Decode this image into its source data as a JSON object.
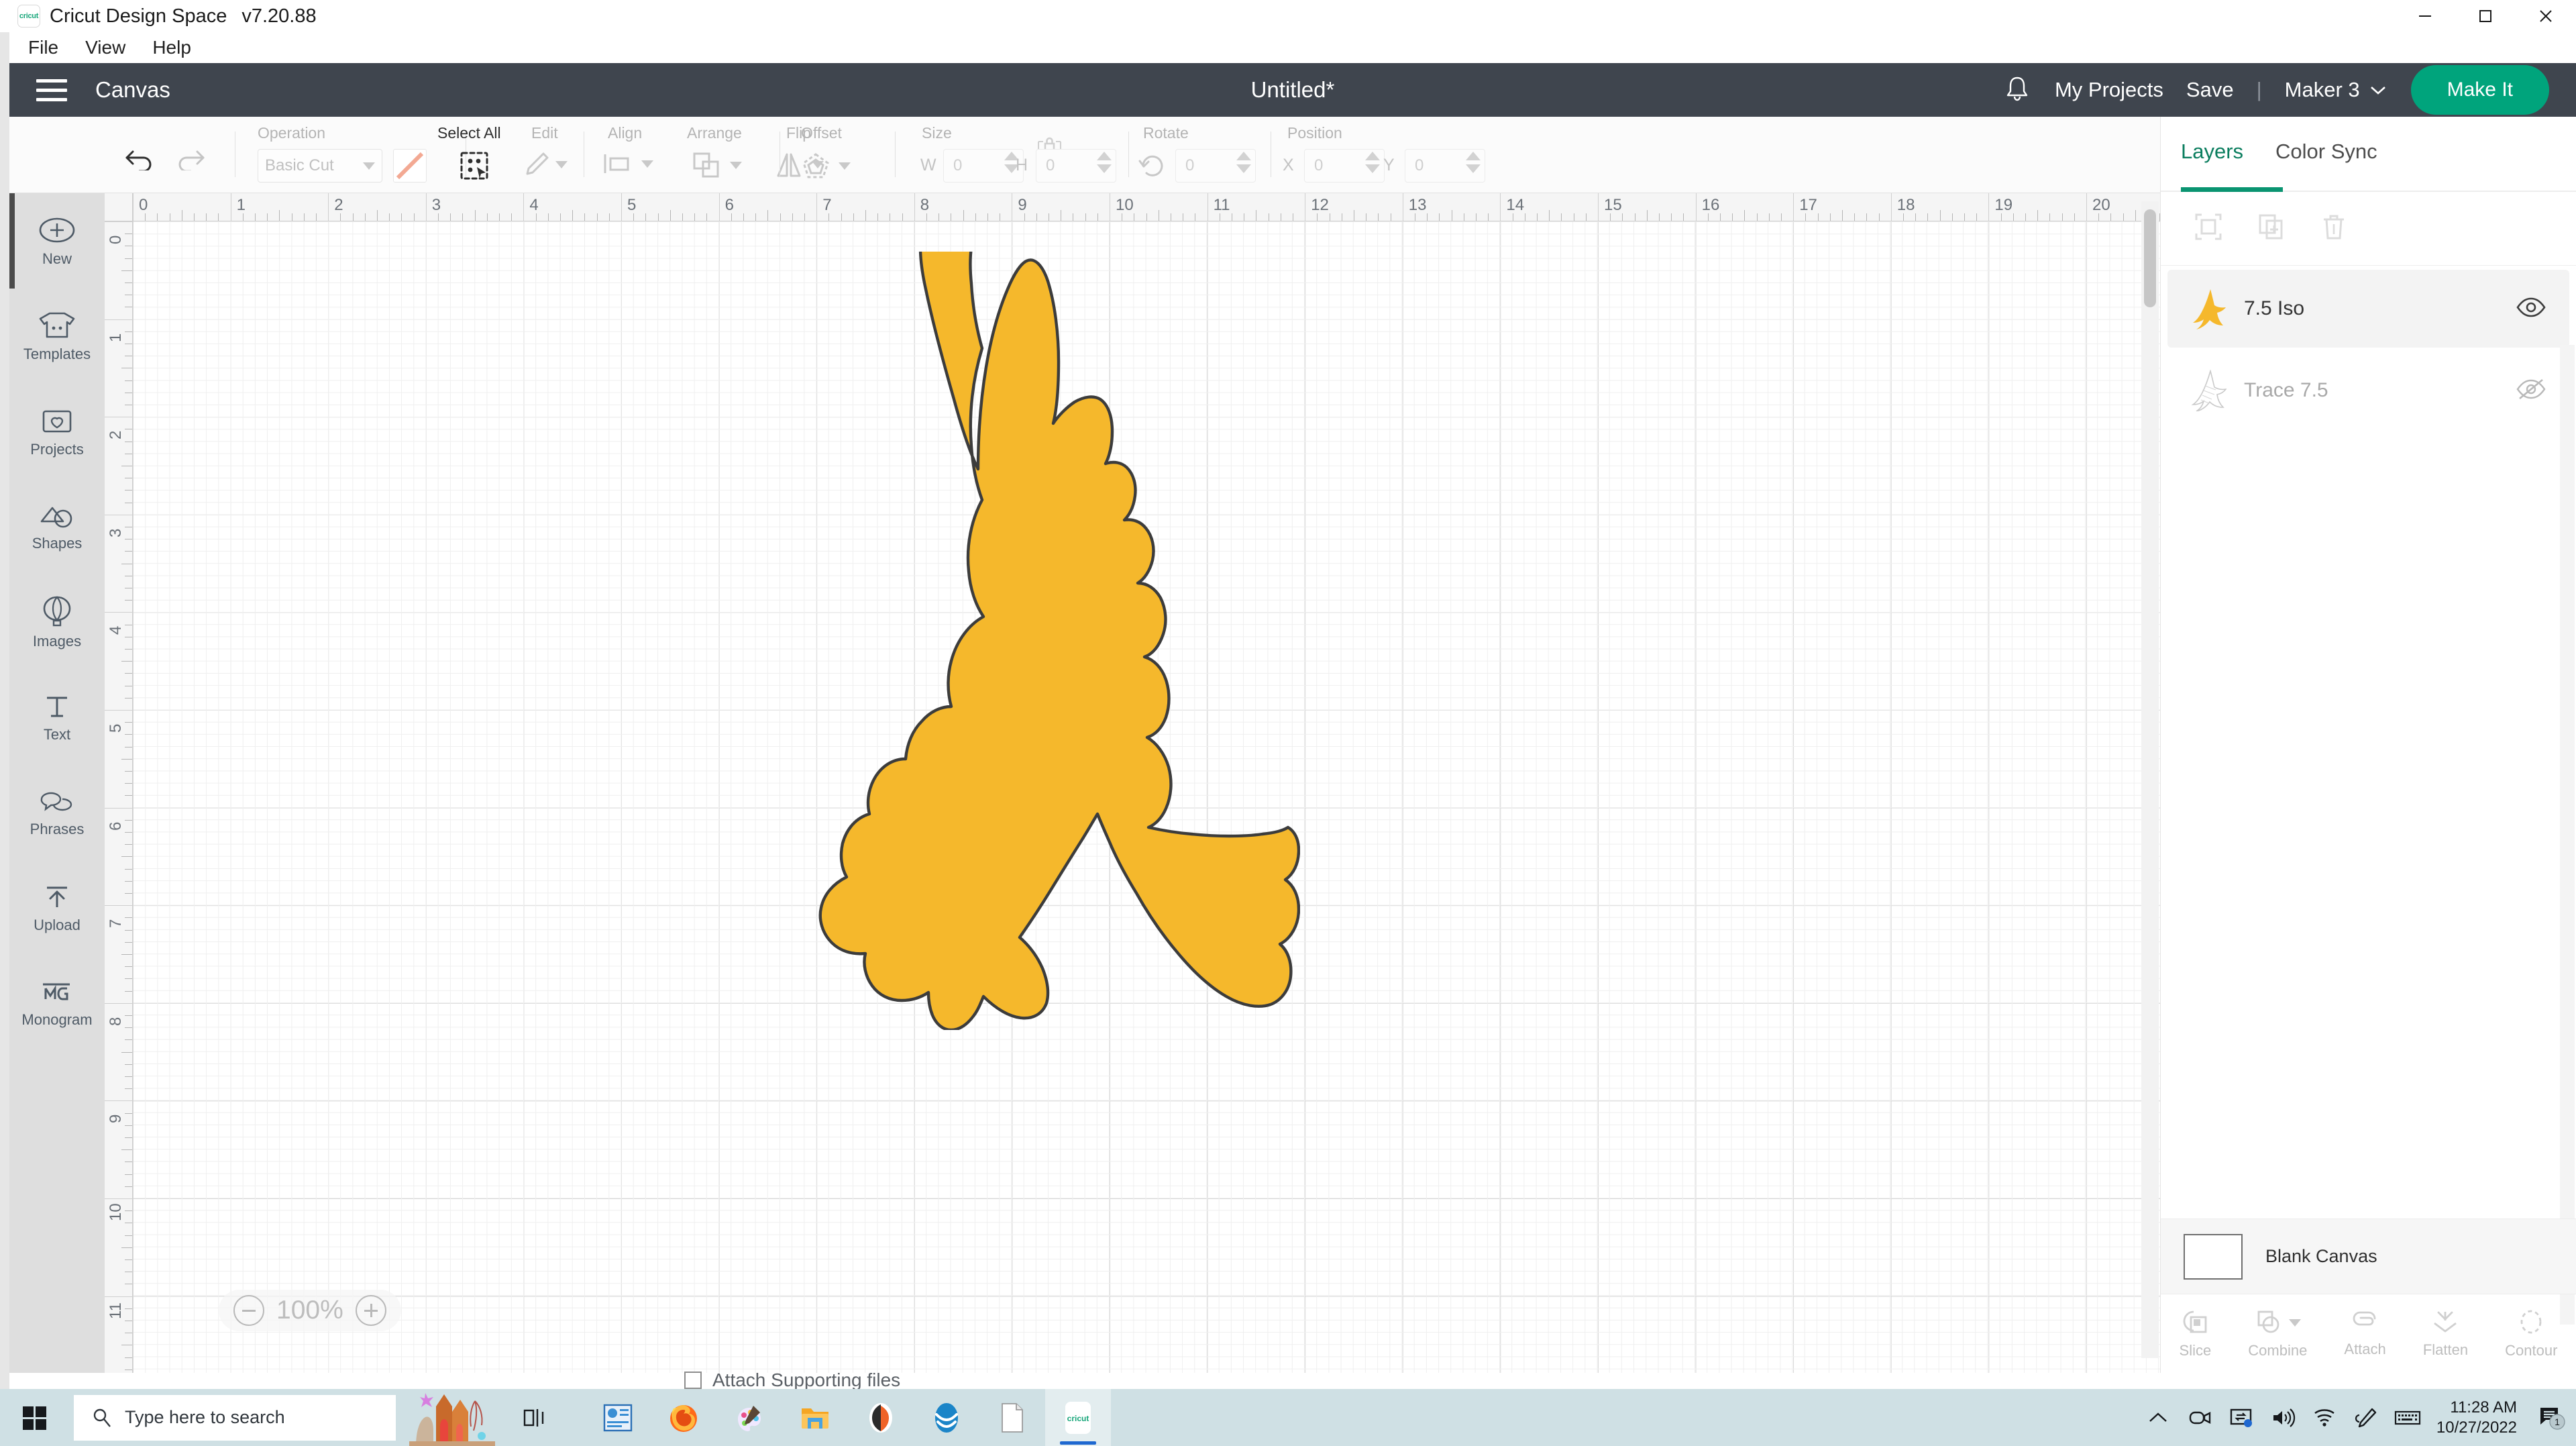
{
  "window": {
    "app_name": "Cricut Design Space",
    "version": "v7.20.88",
    "logo_text": "cricut",
    "menu": [
      "File",
      "View",
      "Help"
    ],
    "controls": {
      "minimize": "minimize-icon",
      "maximize": "maximize-icon",
      "close": "close-icon"
    }
  },
  "header": {
    "menu_icon": "hamburger-icon",
    "canvas_label": "Canvas",
    "project_title": "Untitled*",
    "bell_icon": "notification-bell-icon",
    "my_projects": "My Projects",
    "save": "Save",
    "divider": "|",
    "machine": "Maker 3",
    "machine_caret": "chevron-down-icon",
    "make_it": "Make It",
    "bg_color": "#3f454e",
    "accent_color": "#00a47c"
  },
  "toolbar": {
    "undo_icon": "undo-icon",
    "redo_icon": "redo-icon",
    "operation_label": "Operation",
    "operation_value": "Basic Cut",
    "color_swatch": "#f3a993",
    "select_all_label": "Select All",
    "edit_label": "Edit",
    "align_label": "Align",
    "arrange_label": "Arrange",
    "flip_label": "Flip",
    "offset_label": "Offset",
    "size_label": "Size",
    "size_w_label": "W",
    "size_w_value": "0",
    "size_h_label": "H",
    "size_h_value": "0",
    "lock_icon": "lock-icon",
    "rotate_label": "Rotate",
    "rotate_value": "0",
    "position_label": "Position",
    "position_x_label": "X",
    "position_x_value": "0",
    "position_y_label": "Y",
    "position_y_value": "0"
  },
  "sidebar": {
    "items": [
      {
        "label": "New",
        "icon": "plus-circle-icon"
      },
      {
        "label": "Templates",
        "icon": "tshirt-icon"
      },
      {
        "label": "Projects",
        "icon": "projects-card-icon"
      },
      {
        "label": "Shapes",
        "icon": "shapes-icon"
      },
      {
        "label": "Images",
        "icon": "hot-air-balloon-icon"
      },
      {
        "label": "Text",
        "icon": "text-t-icon"
      },
      {
        "label": "Phrases",
        "icon": "speech-bubbles-icon"
      },
      {
        "label": "Upload",
        "icon": "upload-arrow-icon"
      },
      {
        "label": "Monogram",
        "icon": "monogram-icon"
      }
    ]
  },
  "canvas": {
    "ruler_h_labels": [
      "0",
      "1",
      "2",
      "3",
      "4",
      "5",
      "6",
      "7",
      "8",
      "9",
      "10",
      "11",
      "12",
      "13",
      "14",
      "15",
      "16",
      "17",
      "18",
      "19",
      "20"
    ],
    "ruler_v_labels": [
      "0",
      "1",
      "2",
      "3",
      "4",
      "5",
      "6",
      "7",
      "8",
      "9",
      "10",
      "11"
    ],
    "zoom_level": "100%",
    "zoom_out_icon": "zoom-out-icon",
    "zoom_in_icon": "zoom-in-icon",
    "artwork_name": "flying-bird-silhouette",
    "artwork_fill": "#f5b82c",
    "artwork_stroke": "#3c3c3c"
  },
  "right_panel": {
    "tabs": [
      {
        "label": "Layers",
        "active": true
      },
      {
        "label": "Color Sync",
        "active": false
      }
    ],
    "layer_tools": [
      {
        "name": "duplicate-selection-icon"
      },
      {
        "name": "add-layer-icon"
      },
      {
        "name": "delete-layer-icon"
      }
    ],
    "layers": [
      {
        "name": "7.5 Iso",
        "thumb": "bird-filled-thumb",
        "visible": true,
        "visibility_icon": "eye-icon",
        "selected": true,
        "dim": false
      },
      {
        "name": "Trace 7.5",
        "thumb": "bird-outline-thumb",
        "visible": false,
        "visibility_icon": "eye-off-icon",
        "selected": false,
        "dim": true
      }
    ],
    "blank_canvas_label": "Blank Canvas",
    "operations": [
      {
        "label": "Slice",
        "icon": "slice-icon"
      },
      {
        "label": "Combine",
        "icon": "combine-icon"
      },
      {
        "label": "Attach",
        "icon": "attach-paperclip-icon"
      },
      {
        "label": "Flatten",
        "icon": "flatten-icon"
      },
      {
        "label": "Contour",
        "icon": "contour-icon"
      }
    ]
  },
  "background_window": {
    "text": "Attach Supporting files"
  },
  "taskbar": {
    "start_icon": "windows-start-icon",
    "search_icon": "search-icon",
    "search_placeholder": "Type here to search",
    "taskview_icon": "task-view-icon",
    "apps": [
      {
        "name": "dashboard-app-icon",
        "running": false
      },
      {
        "name": "firefox-icon",
        "running": true
      },
      {
        "name": "paint-app-icon",
        "running": true
      },
      {
        "name": "file-explorer-icon",
        "running": false
      },
      {
        "name": "orange-oval-app-icon",
        "running": false
      },
      {
        "name": "blue-oval-app-icon",
        "running": true
      },
      {
        "name": "document-icon",
        "running": true
      },
      {
        "name": "cricut-app-icon",
        "running": true,
        "active": true,
        "label": "cricut"
      }
    ],
    "tray": [
      "chevron-up-icon",
      "camera-icon",
      "screen-cast-icon",
      "volume-icon",
      "wifi-icon",
      "pen-icon",
      "keyboard-icon"
    ],
    "time": "11:28 AM",
    "date": "10/27/2022",
    "notification_icon": "notification-center-icon",
    "notification_count": "1"
  }
}
